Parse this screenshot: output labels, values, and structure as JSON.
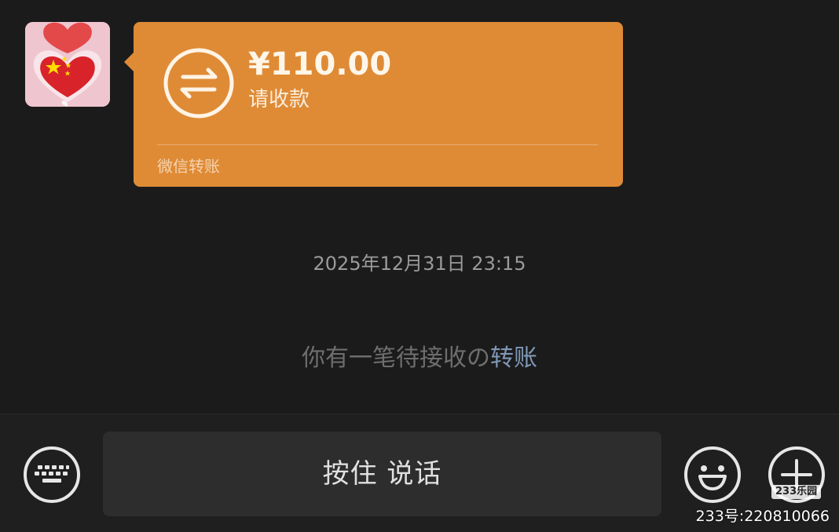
{
  "chat": {
    "transfer_card": {
      "amount": "¥110.00",
      "status": "请收款",
      "footer": "微信转账",
      "background_color": "#df8b36",
      "icon": "transfer-arrows-icon"
    },
    "avatar": {
      "icon": "heart-flag-avatar"
    },
    "timestamp": "2025年12月31日  23:15",
    "notice": {
      "text": "你有一笔待接收の",
      "link": "转账"
    }
  },
  "input_bar": {
    "voice_button_label": "按住 说话",
    "keyboard_icon": "keyboard-icon",
    "emoji_icon": "emoji-icon",
    "plus_icon": "plus-icon"
  },
  "watermark": {
    "logo": "233乐园",
    "id": "233号:220810066"
  }
}
